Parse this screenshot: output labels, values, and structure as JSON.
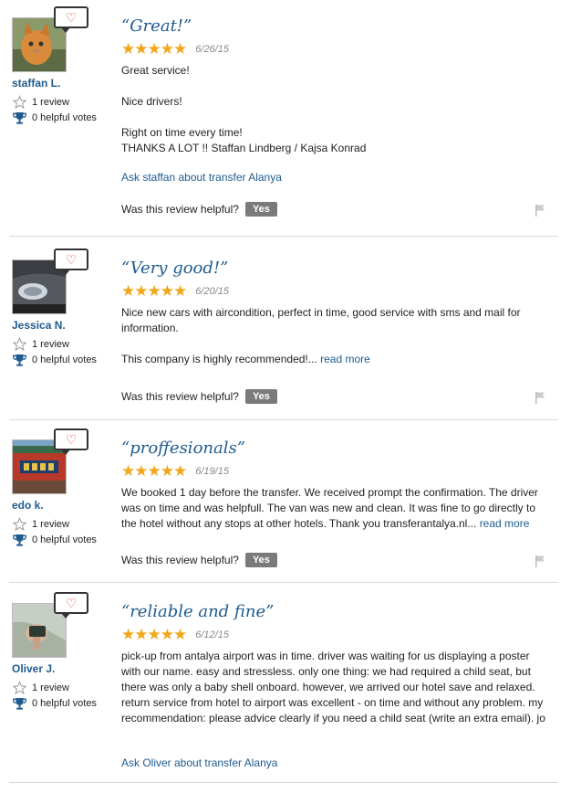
{
  "colors": {
    "accent_link": "#1f5b8f",
    "star": "#f2a619",
    "heart": "#e0452b",
    "yes_button": "#7a7a7a"
  },
  "reviews": [
    {
      "username": "staffan L.",
      "review_count": "1 review",
      "helpful_votes": "0 helpful votes",
      "title": "“Great!”",
      "rating": 5,
      "date": "6/26/15",
      "body": [
        "Great service!",
        "Nice drivers!",
        "Right on time every time!",
        "THANKS A LOT !! Staffan Lindberg / Kajsa Konrad"
      ],
      "ask_link": "Ask staffan about transfer Alanya",
      "helpful_question": "Was this review helpful?",
      "yes_label": "Yes"
    },
    {
      "username": "Jessica N.",
      "review_count": "1 review",
      "helpful_votes": "0 helpful votes",
      "title": "“Very good!”",
      "rating": 5,
      "date": "6/20/15",
      "body": [
        "Nice new cars with aircondition, perfect in time, good service with sms and mail for information.",
        "This company is highly recommended!..."
      ],
      "read_more": "read more",
      "helpful_question": "Was this review helpful?",
      "yes_label": "Yes"
    },
    {
      "username": "edo k.",
      "review_count": "1 review",
      "helpful_votes": "0 helpful votes",
      "title": "“proffesionals”",
      "rating": 5,
      "date": "6/19/15",
      "body": [
        "We booked 1 day before the transfer. We received prompt the confirmation. The driver was on time and was helpfull. The van was new and clean. It was fine to go directly to the hotel without any stops at other hotels. Thank you transferantalya.nl..."
      ],
      "read_more": "read more",
      "helpful_question": "Was this review helpful?",
      "yes_label": "Yes"
    },
    {
      "username": "Oliver J.",
      "review_count": "1 review",
      "helpful_votes": "0 helpful votes",
      "title": "“reliable and fine”",
      "rating": 5,
      "date": "6/12/15",
      "body": [
        "pick-up from antalya airport was in time. driver was waiting for us displaying a poster with our name. easy and stressless. only one thing: we had required a child seat, but there was only a baby shell onboard. however, we arrived our hotel save and relaxed. return service from hotel to airport was excellent - on time and without any problem. my recommendation: please advice clearly if you need a child seat (write an extra email). jo"
      ],
      "ask_link": "Ask Oliver about transfer Alanya"
    }
  ]
}
